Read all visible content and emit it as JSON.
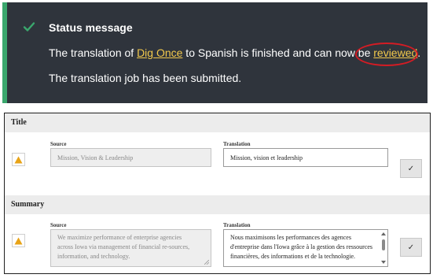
{
  "status": {
    "heading": "Status message",
    "line1_prefix": "The translation of ",
    "line1_link": "Dig Once",
    "line1_middle": " to Spanish is finished and can now be ",
    "line1_link2": "reviewed",
    "line1_suffix": ".",
    "line2": "The translation job has been submitted.",
    "colors": {
      "background": "#2f343c",
      "accent": "#3aa76d",
      "link": "#f2c94c",
      "annotation": "#d41c24"
    }
  },
  "form": {
    "sections": [
      {
        "title": "Title",
        "source_label": "Source",
        "translation_label": "Translation",
        "source_value": "Mission, Vision & Leadership",
        "translation_value": "Mission, vision et leadership",
        "save_label": "✓"
      },
      {
        "title": "Summary",
        "source_label": "Source",
        "translation_label": "Translation",
        "source_value": "We maximize performance of enterprise agencies across Iowa via management of financial re-sources, information, and technology.",
        "translation_value": "Nous maximisons les performances des agences d'entreprise dans l'Iowa grâce à la gestion des ressources financières, des informations et de la technologie.",
        "save_label": "✓"
      }
    ]
  }
}
